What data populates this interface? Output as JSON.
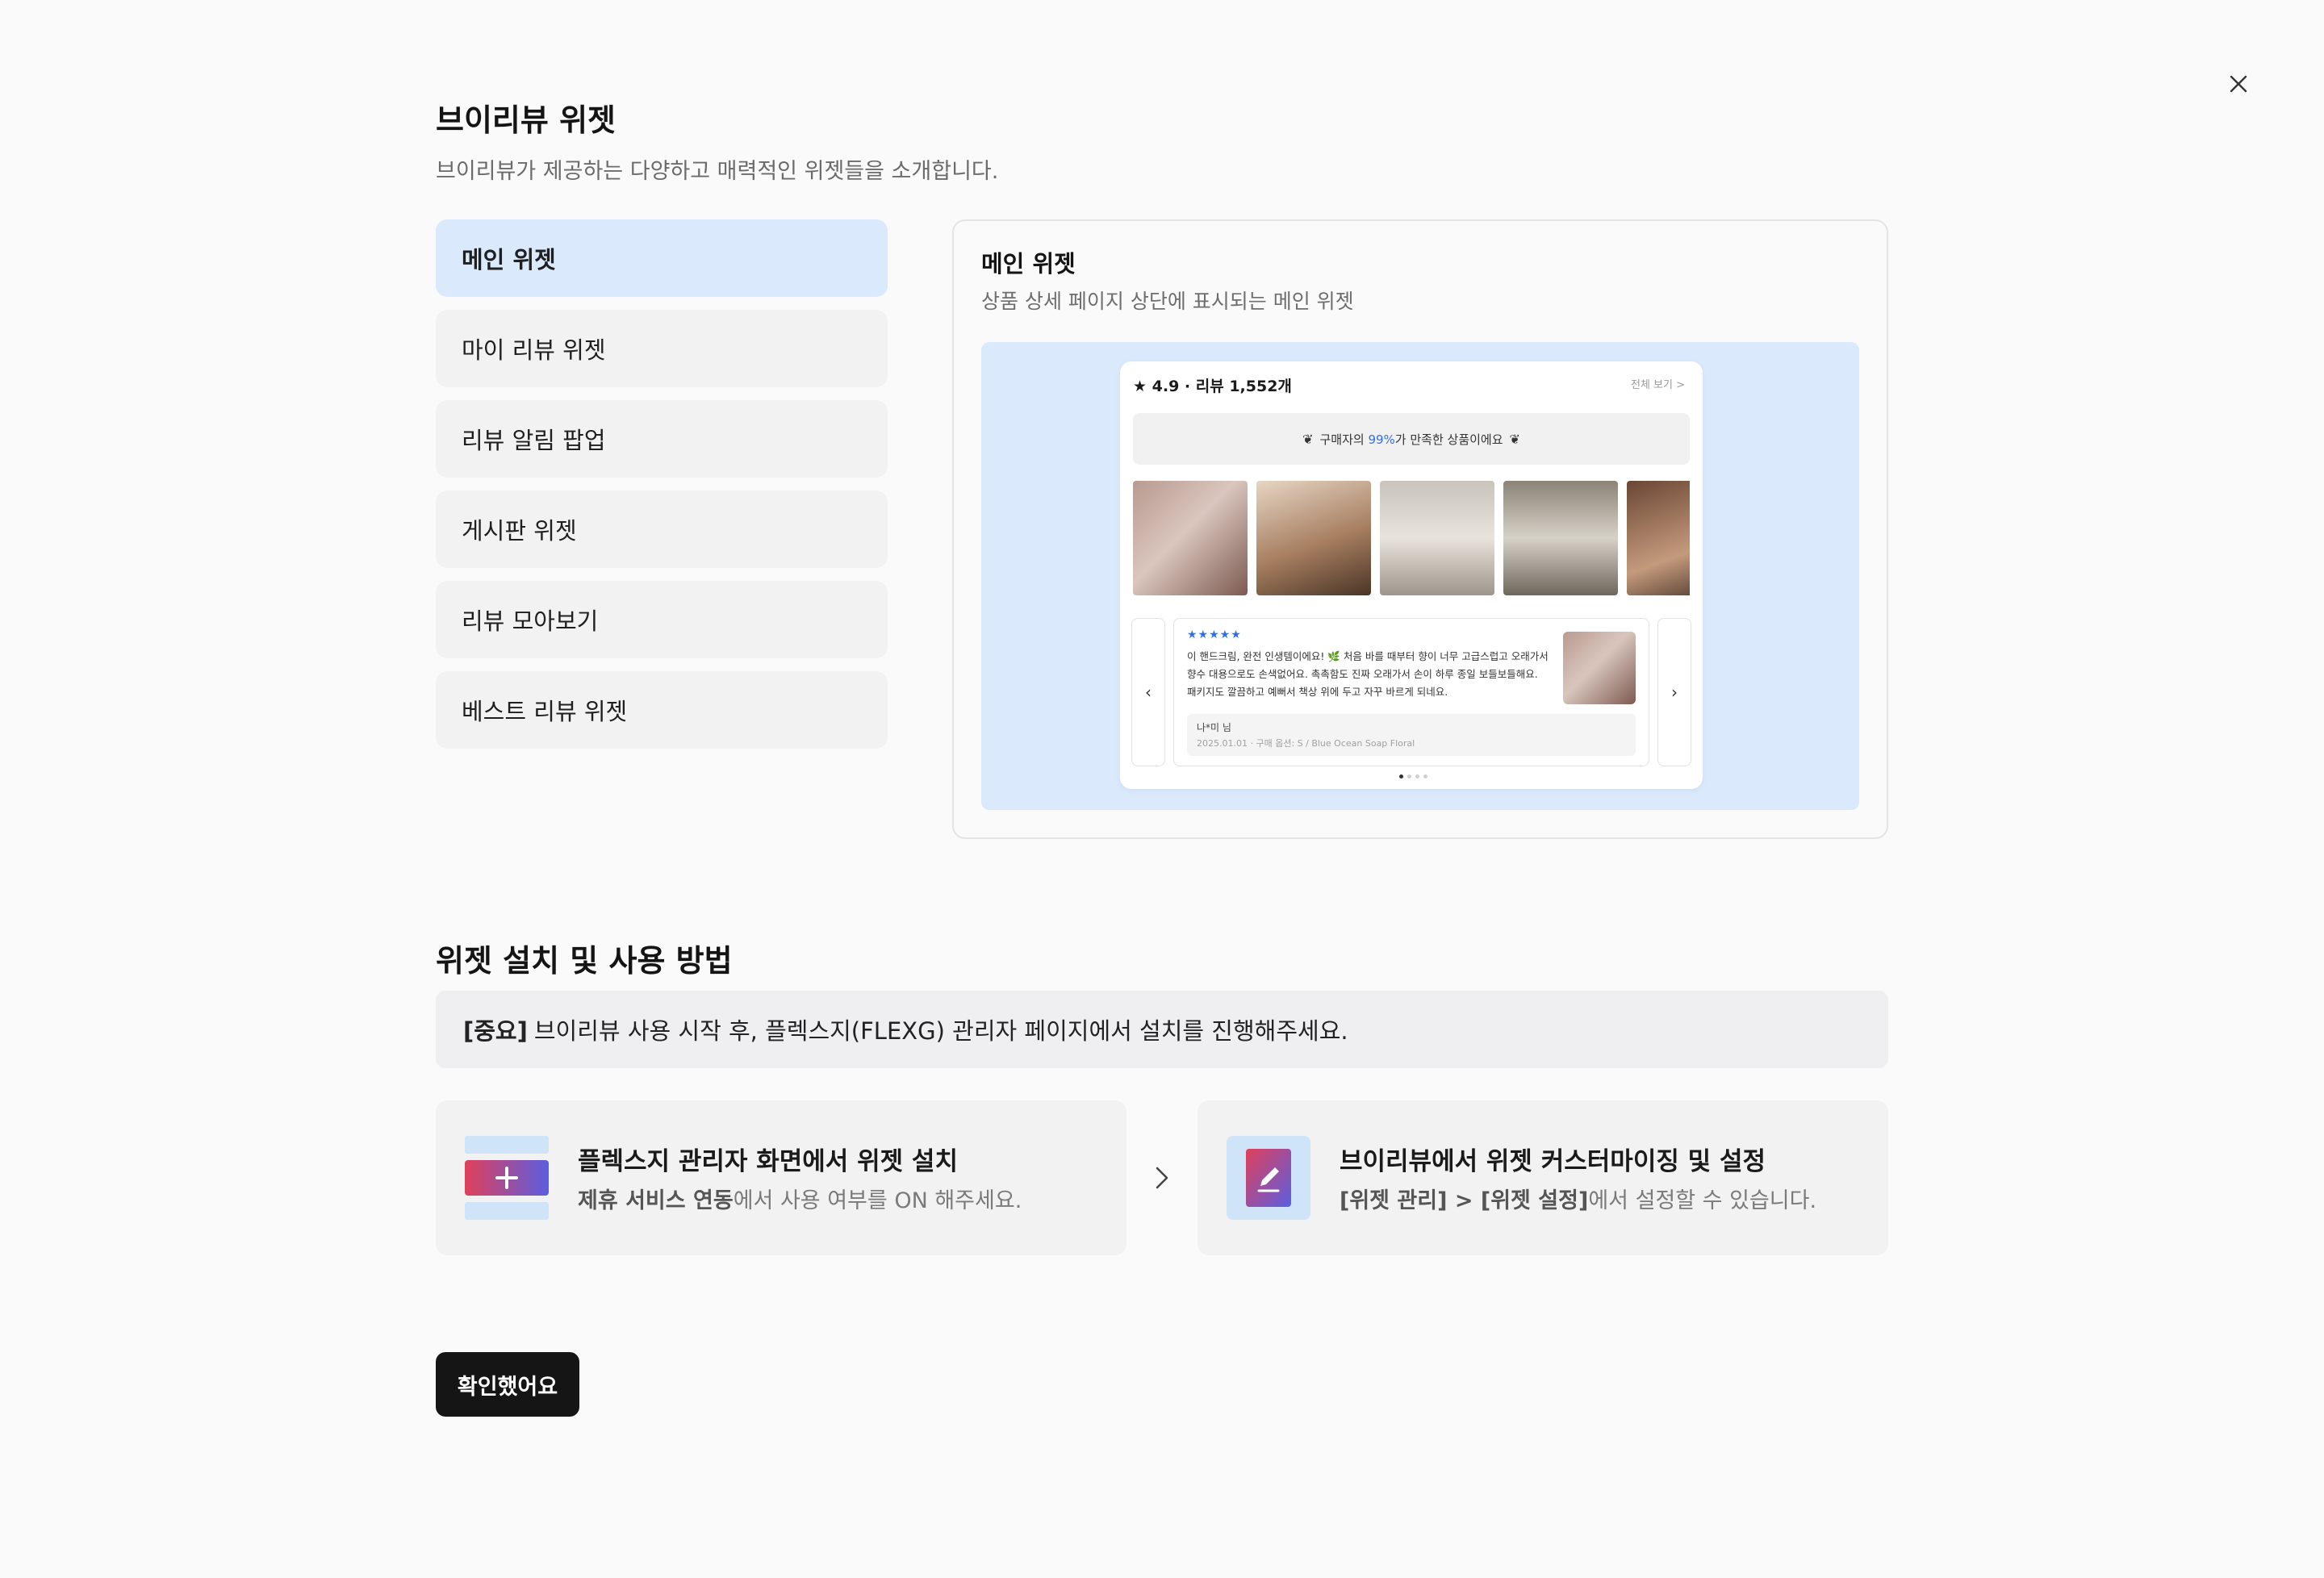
{
  "header": {
    "title": "브이리뷰 위젯",
    "subtitle": "브이리뷰가 제공하는 다양하고 매력적인 위젯들을 소개합니다."
  },
  "nav": {
    "items": [
      {
        "label": "메인 위젯",
        "active": true
      },
      {
        "label": "마이 리뷰 위젯",
        "active": false
      },
      {
        "label": "리뷰 알림 팝업",
        "active": false
      },
      {
        "label": "게시판 위젯",
        "active": false
      },
      {
        "label": "리뷰 모아보기",
        "active": false
      },
      {
        "label": "베스트 리뷰 위젯",
        "active": false
      }
    ]
  },
  "preview": {
    "title": "메인 위젯",
    "description": "상품 상세 페이지 상단에 표시되는 메인 위젯",
    "mock": {
      "rating_text": "★ 4.9 · 리뷰 1,552개",
      "view_all": "전체 보기 >",
      "banner_prefix": "구매자의 ",
      "banner_highlight": "99%",
      "banner_suffix": "가 만족한 상품이에요",
      "stars": "★★★★★",
      "review_text": "이 핸드크림, 완전 인생템이에요! 🌿 처음 바를 때부터 향이 너무 고급스럽고 오래가서 향수 대용으로도 손색없어요. 촉촉함도 진짜 오래가서 손이 하루 종일 보들보들해요. 패키지도 깔끔하고 예뻐서 책상 위에 두고 자꾸 바르게 되네요.",
      "reviewer": "나*미 님",
      "review_meta": "2025.01.01 · 구매 옵션: S / Blue Ocean Soap Floral"
    }
  },
  "install": {
    "title": "위젯 설치 및 사용 방법",
    "notice_bold": "[중요]",
    "notice_text": "브이리뷰 사용 시작 후, 플렉스지(FLEXG) 관리자 페이지에서 설치를 진행해주세요.",
    "steps": [
      {
        "title": "플렉스지 관리자 화면에서 위젯 설치",
        "desc_bold": "제휴 서비스 연동",
        "desc_text": "에서 사용 여부를 ON 해주세요."
      },
      {
        "title": "브이리뷰에서 위젯 커스터마이징 및 설정",
        "desc_bold": "[위젯 관리] > [위젯 설정]",
        "desc_text": "에서 설정할 수 있습니다."
      }
    ]
  },
  "footer": {
    "confirm_label": "확인했어요"
  },
  "colors": {
    "accent_bg": "#dbe9fd",
    "accent_blue": "#2d6ff0",
    "button_dark": "#151515"
  },
  "icons": {
    "close": "close-icon",
    "step_arrow": "chevron-right-icon",
    "step1": "add-widget-icon",
    "step2": "edit-pencil-icon"
  }
}
